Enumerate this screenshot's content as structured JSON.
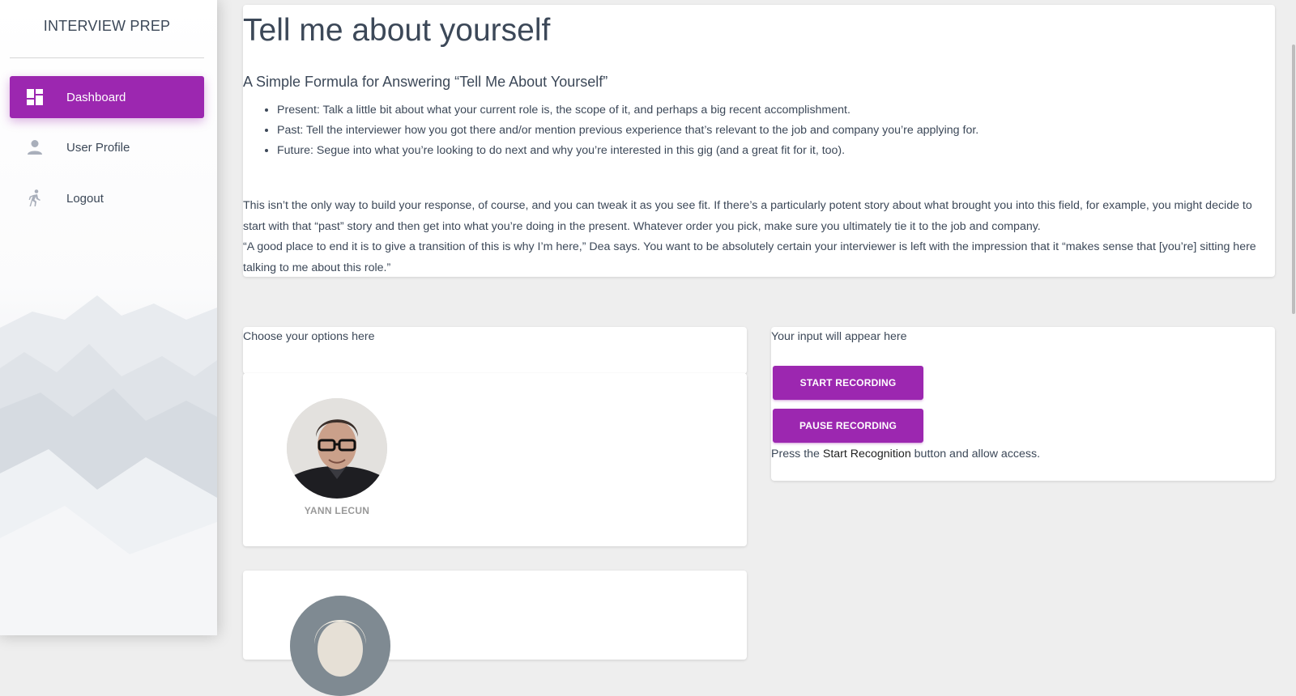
{
  "sidebar": {
    "brand": "INTERVIEW PREP",
    "items": [
      {
        "label": "Dashboard",
        "icon": "dashboard-icon",
        "active": true
      },
      {
        "label": "User Profile",
        "icon": "person-icon",
        "active": false
      },
      {
        "label": "Logout",
        "icon": "run-icon",
        "active": false
      }
    ]
  },
  "intro": {
    "title": "Tell me about yourself",
    "subtitle": "A Simple Formula for Answering “Tell Me About Yourself”",
    "bullets": [
      "Present: Talk a little bit about what your current role is, the scope of it, and perhaps a big recent accomplishment.",
      "Past: Tell the interviewer how you got there and/or mention previous experience that’s relevant to the job and company you’re applying for.",
      "Future: Segue into what you’re looking to do next and why you’re interested in this gig (and a great fit for it, too)."
    ],
    "paragraph1": "This isn’t the only way to build your response, of course, and you can tweak it as you see fit. If there’s a particularly potent story about what brought you into this field, for example, you might decide to start with that “past” story and then get into what you’re doing in the present. Whatever order you pick, make sure you ultimately tie it to the job and company.",
    "paragraph2": "“A good place to end it is to give a transition of this is why I’m here,” Dea says. You want to be absolutely certain your interviewer is left with the impression that it “makes sense that [you’re] sitting here talking to me about this role.”"
  },
  "options": {
    "label": "Choose your options here",
    "people": [
      {
        "name": "YANN LECUN"
      },
      {
        "name": ""
      }
    ]
  },
  "recorder": {
    "label": "Your input will appear here",
    "start_label": "START RECORDING",
    "pause_label": "PAUSE RECORDING",
    "hint_prefix": "Press the ",
    "hint_bold": "Start Recognition",
    "hint_suffix": " button and allow access."
  },
  "colors": {
    "accent": "#9c27b0",
    "background": "#eeeeee",
    "text": "#3c4858"
  }
}
